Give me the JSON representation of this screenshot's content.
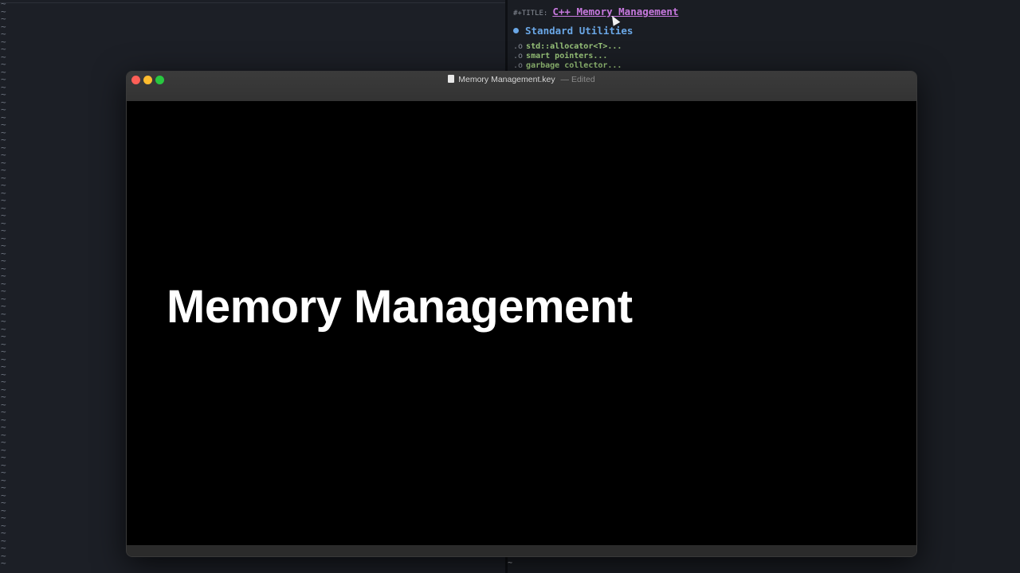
{
  "gutter": {
    "marker": "~"
  },
  "editor": {
    "title_key": "#+TITLE:",
    "title_value": "C++ Memory Management",
    "heading": "Standard Utilities",
    "sub_items": [
      {
        "marker": ".o",
        "text": "std::allocator<T>..."
      },
      {
        "marker": ".o",
        "text": "smart pointers..."
      },
      {
        "marker": ".o",
        "text": "garbage collector..."
      }
    ],
    "bottom_marker": "~"
  },
  "window": {
    "file_name": "Memory Management.key",
    "separator": "—",
    "status": "Edited"
  },
  "slide": {
    "title": "Memory Management"
  },
  "colors": {
    "close": "#ff5f57",
    "minimize": "#febc2e",
    "maximize": "#28c840",
    "title_accent": "#c678dd",
    "heading_accent": "#6aa7e6",
    "list_accent": "#98c379"
  }
}
